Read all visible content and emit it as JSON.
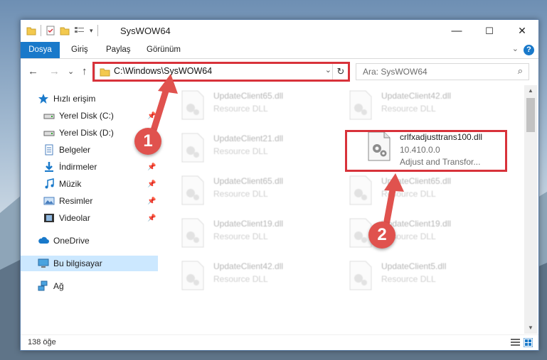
{
  "window": {
    "title": "SysWOW64",
    "controls": {
      "minimize": "—",
      "maximize": "☐",
      "close": "✕"
    }
  },
  "ribbon": {
    "tabs": [
      "Dosya",
      "Giriş",
      "Paylaş",
      "Görünüm"
    ],
    "help_label": "?",
    "accent": "#1979ca"
  },
  "nav": {
    "back": "←",
    "forward": "→",
    "recent": "⌄",
    "up": "↑",
    "address": "C:\\Windows\\SysWOW64",
    "search_placeholder": "Ara: SysWOW64"
  },
  "sidebar": {
    "items": [
      {
        "label": "Hızlı erişim",
        "icon": "star-icon",
        "pinned": false
      },
      {
        "label": "Yerel Disk (C:)",
        "icon": "drive-icon",
        "pinned": true
      },
      {
        "label": "Yerel Disk (D:)",
        "icon": "drive-icon",
        "pinned": true
      },
      {
        "label": "Belgeler",
        "icon": "documents-icon",
        "pinned": true
      },
      {
        "label": "İndirmeler",
        "icon": "download-icon",
        "pinned": true
      },
      {
        "label": "Müzik",
        "icon": "music-icon",
        "pinned": true
      },
      {
        "label": "Resimler",
        "icon": "pictures-icon",
        "pinned": true
      },
      {
        "label": "Videolar",
        "icon": "videos-icon",
        "pinned": true
      },
      {
        "label": "OneDrive",
        "icon": "cloud-icon",
        "pinned": false
      },
      {
        "label": "Bu bilgisayar",
        "icon": "computer-icon",
        "pinned": false,
        "selected": true
      },
      {
        "label": "Ağ",
        "icon": "network-icon",
        "pinned": false
      }
    ]
  },
  "files": [
    {
      "name": "UpdateClient65.dll",
      "type": "Resource DLL"
    },
    {
      "name": "UpdateClient42.dll",
      "type": "Resource DLL"
    },
    {
      "name": "UpdateClient21.dll",
      "type": "Resource DLL"
    },
    {
      "name": "crlfxadjusttrans100.dll",
      "version": "10.410.0.0",
      "description": "Adjust and Transfor...",
      "highlighted": true
    },
    {
      "name": "UpdateClient65.dll",
      "type": "Resource DLL"
    },
    {
      "name": "UpdateClient65.dll",
      "type": "Resource DLL"
    },
    {
      "name": "UpdateClient19.dll",
      "type": "Resource DLL"
    },
    {
      "name": "UpdateClient19.dll",
      "type": "Resource DLL"
    },
    {
      "name": "UpdateClient42.dll",
      "type": "Resource DLL"
    },
    {
      "name": "UpdateClient5.dll",
      "type": "Resource DLL"
    }
  ],
  "status": {
    "count": "138 öğe"
  },
  "annotations": {
    "step1": "1",
    "step2": "2",
    "color": "#e0524e"
  }
}
